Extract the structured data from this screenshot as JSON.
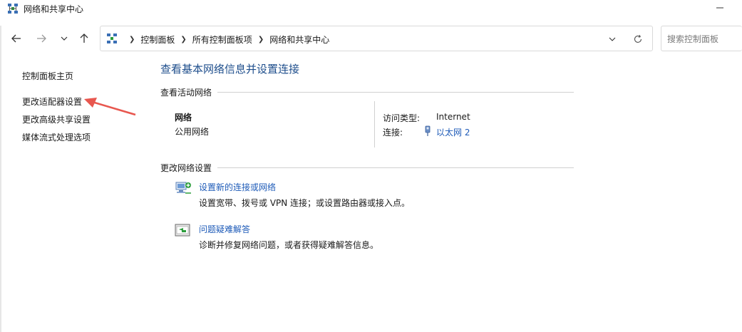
{
  "window": {
    "title": "网络和共享中心"
  },
  "nav": {
    "breadcrumbs": [
      "控制面板",
      "所有控制面板项",
      "网络和共享中心"
    ],
    "search_placeholder": "搜索控制面板"
  },
  "sidebar": {
    "items": [
      {
        "label": "控制面板主页"
      },
      {
        "label": "更改适配器设置"
      },
      {
        "label": "更改高级共享设置"
      },
      {
        "label": "媒体流式处理选项"
      }
    ]
  },
  "main": {
    "title": "查看基本网络信息并设置连接",
    "active_section": "查看活动网络",
    "network": {
      "name": "网络",
      "category": "公用网络",
      "access_label": "访问类型:",
      "access_value": "Internet",
      "connection_label": "连接:",
      "connection_value": "以太网 2"
    },
    "change_section": "更改网络设置",
    "tasks": [
      {
        "link": "设置新的连接或网络",
        "desc": "设置宽带、拨号或 VPN 连接；或设置路由器或接入点。",
        "icon": "new-connection-icon"
      },
      {
        "link": "问题疑难解答",
        "desc": "诊断并修复网络问题，或者获得疑难解答信息。",
        "icon": "troubleshoot-icon"
      }
    ]
  },
  "colors": {
    "link": "#1e5bb8",
    "title": "#1e4e8c",
    "annotation_arrow": "#e8574f"
  }
}
